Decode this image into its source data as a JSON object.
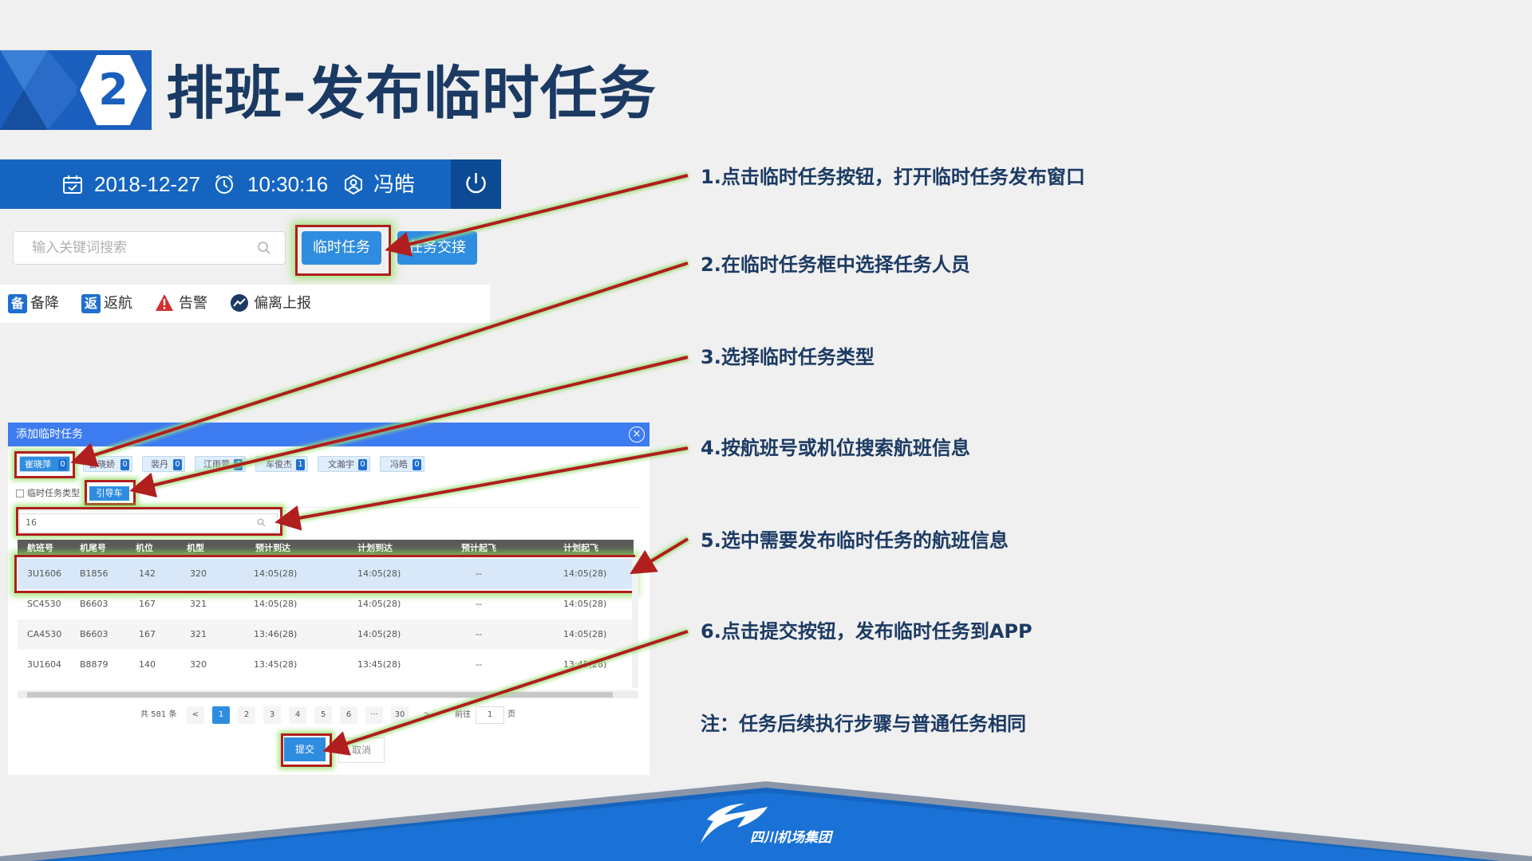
{
  "header": {
    "number": "2",
    "title": "排班-发布临时任务"
  },
  "topbar": {
    "date": "2018-12-27",
    "time": "10:30:16",
    "user": "冯皓"
  },
  "search": {
    "placeholder": "输入关键词搜索"
  },
  "buttons": {
    "temp_task": "临时任务",
    "handover": "任务交接"
  },
  "legend": [
    {
      "icon_text": "备",
      "label": "备降",
      "color": "#1f6fd0"
    },
    {
      "icon_text": "返",
      "label": "返航",
      "color": "#1f6fd0"
    },
    {
      "icon_text": "!",
      "label": "告警",
      "color": "#d32f2f"
    },
    {
      "icon_text": "~",
      "label": "偏离上报",
      "color": "#1b3a63"
    }
  ],
  "dialog": {
    "title": "添加临时任务",
    "staff": [
      {
        "name": "崔晓萍",
        "count": "0"
      },
      {
        "name": "雷晓娇",
        "count": "0"
      },
      {
        "name": "裴丹",
        "count": "0"
      },
      {
        "name": "江雨萱",
        "count": "3"
      },
      {
        "name": "车俊杰",
        "count": "1"
      },
      {
        "name": "文瀚宇",
        "count": "0"
      },
      {
        "name": "冯皓",
        "count": "0"
      }
    ],
    "task_type_label": "临时任务类型",
    "task_type": "引导车",
    "flight_search_value": "16",
    "columns": [
      "航班号",
      "机尾号",
      "机位",
      "机型",
      "预计到达",
      "计划到达",
      "预计起飞",
      "计划起飞"
    ],
    "rows": [
      [
        "3U1606",
        "B1856",
        "142",
        "320",
        "14:05(28)",
        "14:05(28)",
        "--",
        "14:05(28)"
      ],
      [
        "SC4530",
        "B6603",
        "167",
        "321",
        "14:05(28)",
        "14:05(28)",
        "--",
        "14:05(28)"
      ],
      [
        "CA4530",
        "B6603",
        "167",
        "321",
        "13:46(28)",
        "14:05(28)",
        "--",
        "14:05(28)"
      ],
      [
        "3U1604",
        "B8879",
        "140",
        "320",
        "13:45(28)",
        "13:45(28)",
        "--",
        "13:45(28)"
      ]
    ],
    "pagination": {
      "total": "共 581 条",
      "prev": "<",
      "pages": [
        "1",
        "2",
        "3",
        "4",
        "5",
        "6",
        "···",
        "30"
      ],
      "next": ">",
      "goto_label": "前往",
      "goto_value": "1",
      "goto_suffix": "页"
    },
    "submit": "提交",
    "cancel": "取消"
  },
  "steps": [
    "1.点击临时任务按钮，打开临时任务发布窗口",
    "2.在临时任务框中选择任务人员",
    "3.选择临时任务类型",
    "4.按航班号或机位搜索航班信息",
    "5.选中需要发布临时任务的航班信息",
    "6.点击提交按钮，发布临时任务到APP"
  ],
  "note": "注：任务后续执行步骤与普通任务相同",
  "footer": {
    "logo_text": "四川机场集团"
  },
  "colors": {
    "primary": "#1565c0",
    "accent": "#2f8de0",
    "annotation": "#b01e1e",
    "title": "#1b3a63"
  }
}
